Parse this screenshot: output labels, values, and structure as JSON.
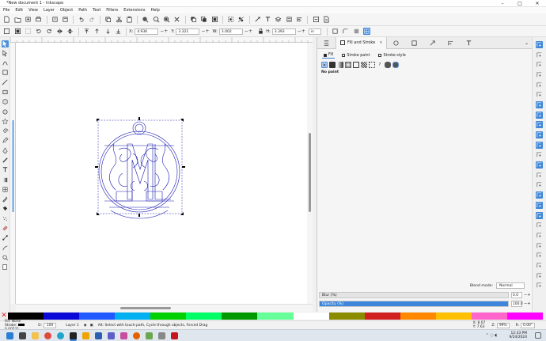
{
  "window": {
    "title": "*New document 1 - Inkscape",
    "controls": [
      "–",
      "□",
      "✕"
    ]
  },
  "menu": [
    "File",
    "Edit",
    "View",
    "Layer",
    "Object",
    "Path",
    "Text",
    "Filters",
    "Extensions",
    "Help"
  ],
  "ctrl": {
    "x_label": "X:",
    "x_value": "4.936",
    "y_label": "Y:",
    "y_value": "3.321",
    "w_label": "W:",
    "w_value": "3.002",
    "h_label": "H:",
    "h_value": "3.393",
    "unit": "in"
  },
  "dock": {
    "tab_title": "Fill and Stroke",
    "tab_close": "×",
    "subtabs": {
      "fill": "Fill",
      "stroke_paint": "Stroke paint",
      "stroke_style": "Stroke style"
    },
    "no_paint": "No paint",
    "blend_label": "Blend mode:",
    "blend_value": "Normal",
    "blur_label": "Blur (%)",
    "blur_value": "0.0",
    "blur_fraction": 0,
    "opacity_label": "Opacity (%)",
    "opacity_value": "100.0",
    "opacity_fraction": 1.0
  },
  "palette": {
    "none_glyph": "✕",
    "colors": [
      "#000000",
      "#0a0ad8",
      "#1f59ff",
      "#00b0f0",
      "#00d000",
      "#00ff66",
      "#009900",
      "#66ff99",
      "#ffffff",
      "#8b8b00",
      "#d02020",
      "#ff8800",
      "#ffc000",
      "#ff66cc",
      "#ff00ff"
    ]
  },
  "status": {
    "fill_label": "Fill:",
    "fill_value": "None",
    "stroke_label": "Stroke:",
    "stroke_value": "0.00521",
    "opacity_label": "O:",
    "opacity_value": "100",
    "layer": "Layer 1",
    "message": "Alt: Select with touch-path, Cycle through objects, Forced Drag",
    "cursor_x": "X: 8.07",
    "cursor_y": "Y: 7.63",
    "zoom_label": "Z:",
    "zoom": "99%",
    "rotation_label": "R:",
    "rotation": "0.00°"
  },
  "taskbar": {
    "time": "12:33 PM",
    "date": "9/24/2024"
  },
  "icons": {
    "toolbox": [
      "selector-icon",
      "node-icon",
      "tweak-icon",
      "zoom-icon",
      "measure-icon",
      "rect-icon",
      "3dbox-icon",
      "ellipse-icon",
      "star-icon",
      "spiral-icon",
      "pencil-icon",
      "pen-icon",
      "calligraphy-icon",
      "text-icon",
      "gradient-icon",
      "mesh-icon",
      "dropper-icon",
      "bucket-icon",
      "spray-icon",
      "eraser-icon",
      "connector-icon",
      "lpe-icon",
      "zoom-tool-icon",
      "pages-icon"
    ]
  },
  "colors": {
    "accent": "#3d86dc",
    "selection": "#1c1cb0"
  }
}
